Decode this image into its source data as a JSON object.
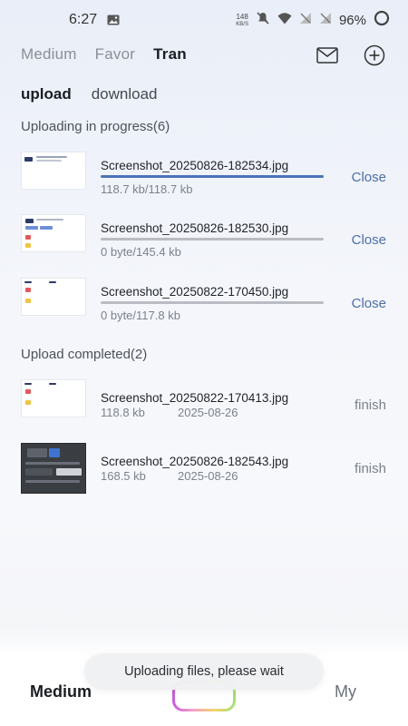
{
  "status_bar": {
    "time": "6:27",
    "net_speed_value": "148",
    "net_speed_unit": "KB/S",
    "battery": "96%"
  },
  "top_tabs": [
    {
      "label": "Medium",
      "active": false
    },
    {
      "label": "Favor",
      "active": false
    },
    {
      "label": "Tran",
      "active": true
    }
  ],
  "top_actions": {
    "mail_icon": "mail-icon",
    "add_icon": "plus-circle-icon"
  },
  "sub_tabs": [
    {
      "label": "upload",
      "active": true
    },
    {
      "label": "download",
      "active": false
    }
  ],
  "uploading": {
    "title": "Uploading in progress(6)",
    "items": [
      {
        "name": "Screenshot_20250826-182534.jpg",
        "size": "118.7 kb/118.7 kb",
        "progress": 1.0,
        "action": "Close"
      },
      {
        "name": "Screenshot_20250826-182530.jpg",
        "size": "0 byte/145.4 kb",
        "progress": 0.0,
        "action": "Close"
      },
      {
        "name": "Screenshot_20250822-170450.jpg",
        "size": "0 byte/117.8 kb",
        "progress": 0.0,
        "action": "Close"
      }
    ]
  },
  "completed": {
    "title": "Upload completed(2)",
    "items": [
      {
        "name": "Screenshot_20250822-170413.jpg",
        "size": "118.8 kb",
        "date": "2025-08-26",
        "action": "finish"
      },
      {
        "name": "Screenshot_20250826-182543.jpg",
        "size": "168.5 kb",
        "date": "2025-08-26",
        "action": "finish"
      }
    ]
  },
  "bottom_nav": {
    "left": "Medium",
    "right": "My"
  },
  "toast": "Uploading files, please wait",
  "colors": {
    "accent": "#4b73b8",
    "close_link": "#4c6fa8",
    "muted": "#7c828b"
  }
}
